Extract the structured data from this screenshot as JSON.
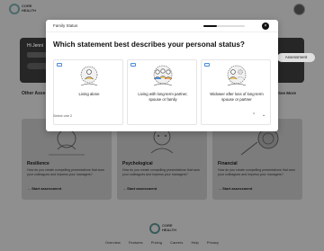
{
  "app": {
    "logo_text": "CORE HEALTH"
  },
  "hero": {
    "greeting": "Hi Jenni",
    "button_label": "Assessment"
  },
  "section": {
    "title": "Other Asse",
    "see_more": "See More"
  },
  "cards": [
    {
      "title": "Resilience",
      "desc": "How do you create compelling presentations that wow your colleagues and impress your managers?",
      "cta": "Start assessment"
    },
    {
      "title": "Psychological",
      "desc": "How do you create compelling presentations that wow your colleagues and impress your managers?",
      "cta": "Start assessment"
    },
    {
      "title": "Financial",
      "desc": "How do you create compelling presentations that wow your colleagues and impress your managers?",
      "cta": "Start assessment"
    }
  ],
  "footer": {
    "links": [
      "Overview",
      "Features",
      "Pricing",
      "Careers",
      "Help",
      "Privacy"
    ]
  },
  "modal": {
    "label": "Family Status",
    "progress": 0.33,
    "question": "Which statement best describes your personal status?",
    "options": [
      {
        "label": "Living alone"
      },
      {
        "label": "Living with long-term partner, spouse or family"
      },
      {
        "label": "Widower after loss of long-term spouse or partner"
      }
    ],
    "select_note": "Select one",
    "select_count": "2"
  },
  "colors": {
    "overlay": "#8f8f8f",
    "modal_bg": "#ffffff",
    "accent": "#111111",
    "check_border": "#4a90e2"
  }
}
